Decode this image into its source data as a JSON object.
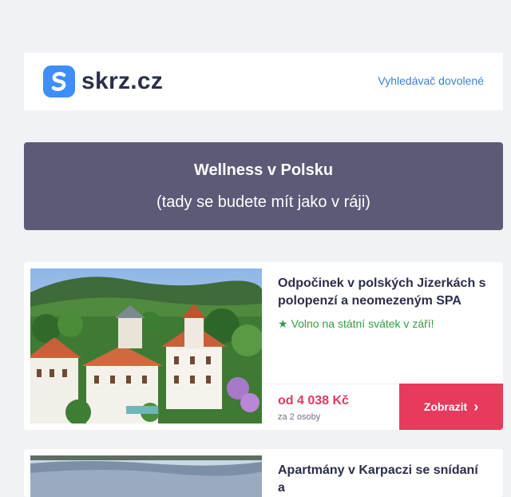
{
  "header": {
    "logo_text": "skrz.cz",
    "link_label": "Vyhledávač dovolené"
  },
  "banner": {
    "title": "Wellness v Polsku",
    "subtitle": "(tady se budete mít jako v ráji)"
  },
  "offers": [
    {
      "title": "Odpočinek v polských Jizerkách s polopenzí a neomezeným SPA",
      "note": "Volno na státní svátek v září!",
      "note_icon": "star-icon",
      "price": "od 4 038 Kč",
      "price_note": "za 2 osoby",
      "cta_label": "Zobrazit"
    },
    {
      "title": "Apartmány v Karpaczi se snídaní a"
    }
  ],
  "colors": {
    "brand": "#3d8ef8",
    "banner": "#5c5a76",
    "cta": "#e83a5c",
    "price": "#e03a5e",
    "note": "#2f9e44",
    "link": "#3a7fd6"
  }
}
